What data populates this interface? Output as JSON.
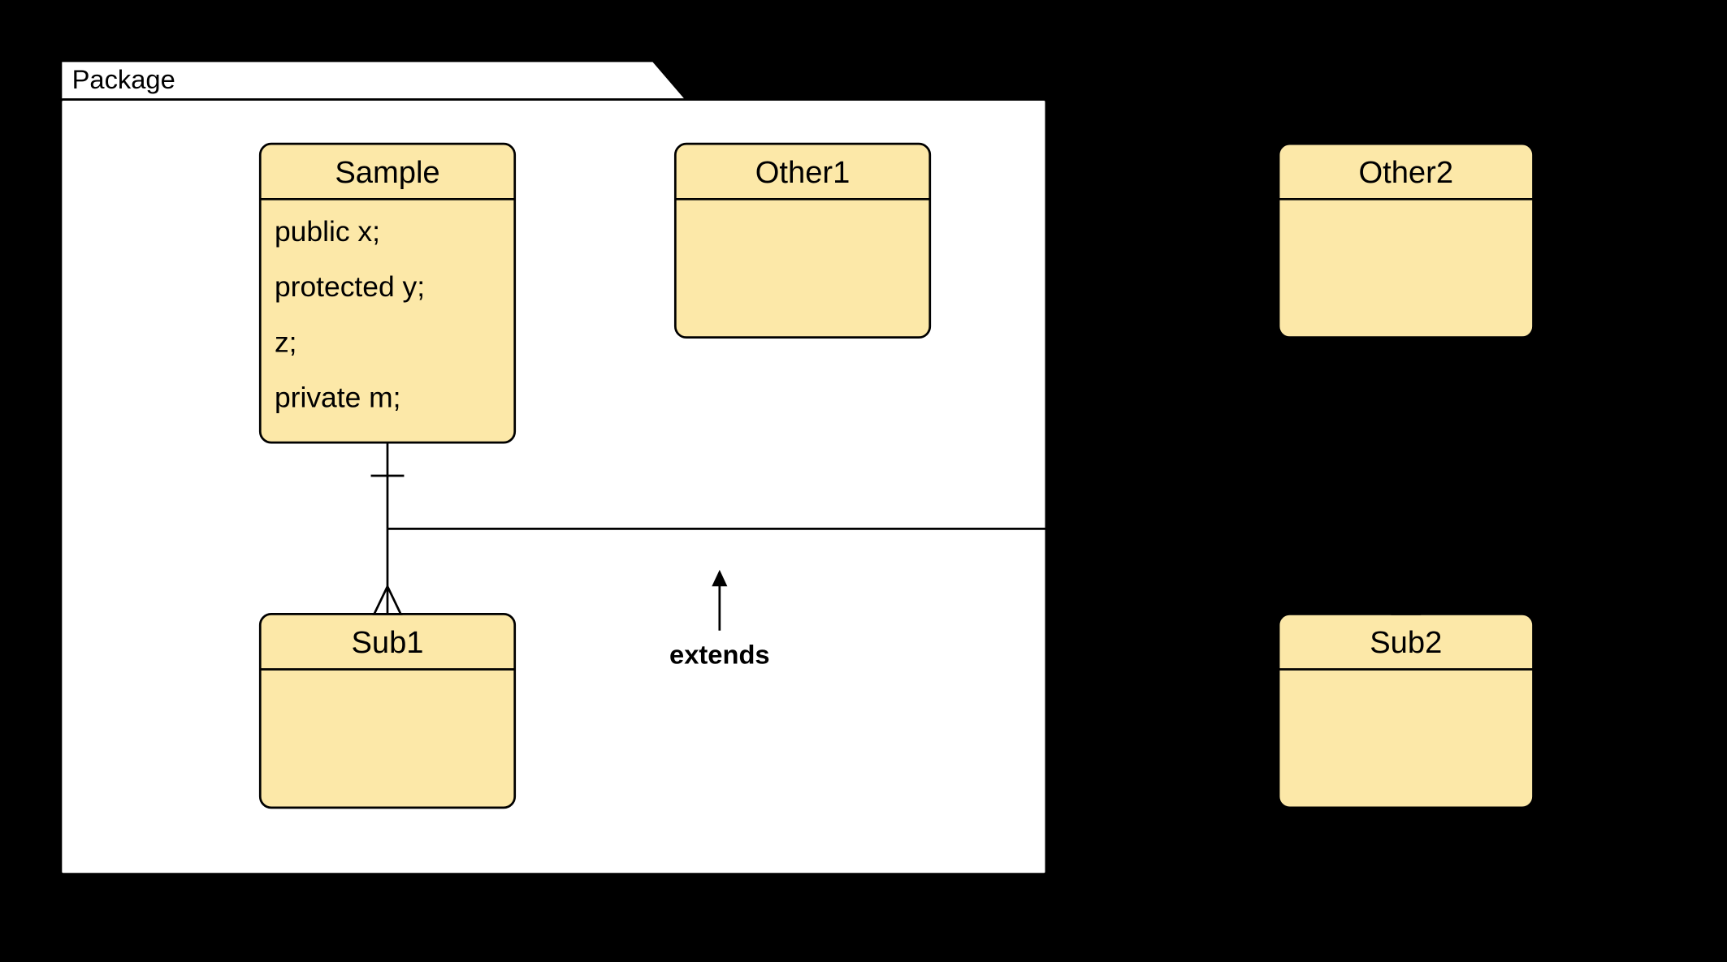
{
  "package": {
    "label": "Package"
  },
  "classes": {
    "sample": {
      "name": "Sample",
      "attrs": [
        "public x;",
        "protected y;",
        "z;",
        "private m;"
      ]
    },
    "other1": {
      "name": "Other1"
    },
    "other2": {
      "name": "Other2"
    },
    "sub1": {
      "name": "Sub1"
    },
    "sub2": {
      "name": "Sub2"
    }
  },
  "relations": {
    "extends": {
      "label": "extends"
    }
  }
}
